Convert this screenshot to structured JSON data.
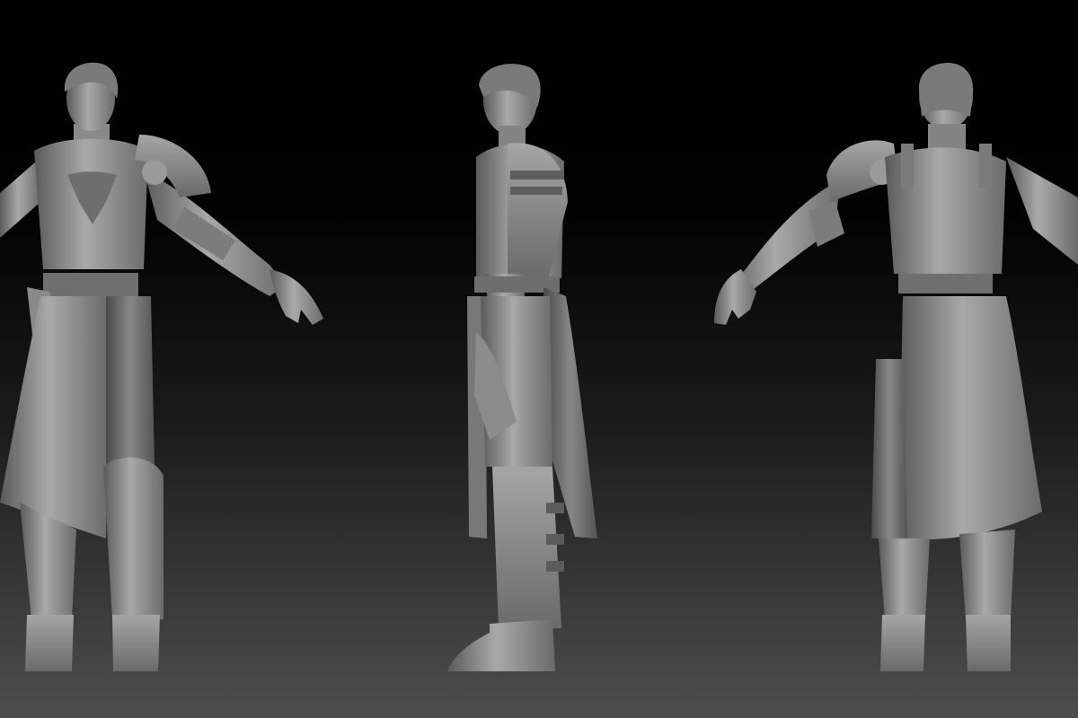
{
  "scene": {
    "background_top_color": "#000000",
    "background_bottom_color": "#4e4e4e",
    "material_color": "#8f8f8f",
    "views": [
      {
        "view": "front"
      },
      {
        "view": "side"
      },
      {
        "view": "back"
      }
    ]
  }
}
